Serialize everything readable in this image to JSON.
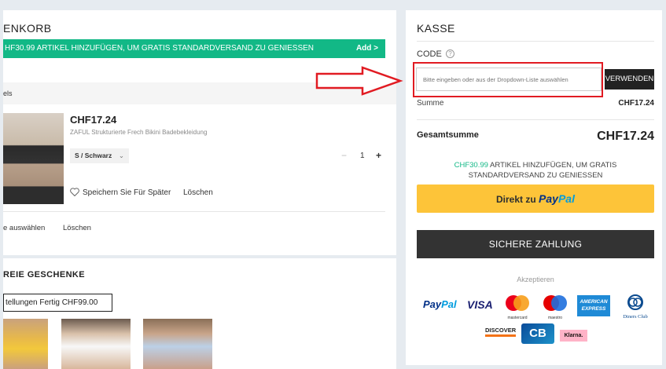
{
  "cart": {
    "title": "ENKORB",
    "promo_bar": "HF30.99 ARTIKEL HINZUFÜGEN, UM GRATIS STANDARDVERSAND ZU GENIESSEN",
    "promo_add": "Add >",
    "section_label": "els",
    "item": {
      "price": "CHF17.24",
      "name": "ZAFUL Strukturierte Frech Bikini Badebekleidung",
      "variant": "S / Schwarz",
      "quantity": "1",
      "minus": "−",
      "plus": "+",
      "save_later": "Speichern Sie Für Später",
      "delete": "Löschen"
    },
    "footer": {
      "select_all": "e auswählen",
      "delete": "Löschen"
    }
  },
  "gifts": {
    "title": "REIE GESCHENKE",
    "button": "tellungen Fertig CHF99.00"
  },
  "checkout": {
    "title": "KASSE",
    "code_label": "CODE",
    "code_help": "?",
    "code_placeholder": "Bitte eingeben oder aus der Dropdown-Liste auswählen",
    "apply_label": "VERWENDEN",
    "subtotal_label": "Summe",
    "subtotal_value": "CHF17.24",
    "total_label": "Gesamtsumme",
    "total_value": "CHF17.24",
    "promo_amount": "CHF30.99",
    "promo_text_1": " ARTIKEL HINZUFÜGEN, UM GRATIS",
    "promo_text_2": "STANDARDVERSAND ZU GENIESSEN",
    "paypal_prefix": "Direkt zu ",
    "paypal_logo_1": "Pay",
    "paypal_logo_2": "Pal",
    "secure_pay_label": "SICHERE ZAHLUNG",
    "accepted_label": "Akzeptieren"
  },
  "payment_logos": {
    "paypal_1": "Pay",
    "paypal_2": "Pal",
    "visa": "VISA",
    "mastercard": "mastercard",
    "maestro": "maestro",
    "amex_1": "AMERICAN",
    "amex_2": "EXPRESS",
    "diners": "Diners Club",
    "discover": "DISCOVER",
    "cb": "CB",
    "klarna": "Klarna."
  },
  "colors": {
    "accent_green": "#12b886",
    "paypal_yellow": "#fdc439",
    "highlight_red": "#e11b22",
    "dark_button": "#333333"
  }
}
